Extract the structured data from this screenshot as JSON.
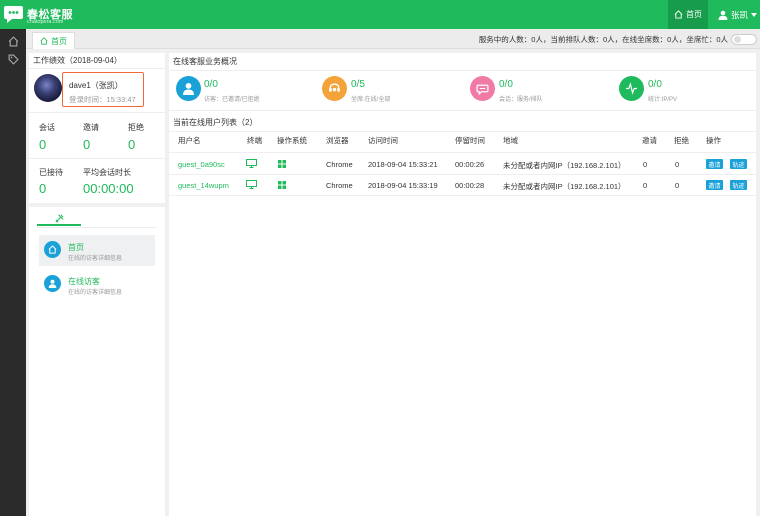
{
  "header": {
    "logo_name": "春松客服",
    "logo_sub": "chatopera.com",
    "home_label": "首页",
    "user_label": "张凯"
  },
  "tabbar": {
    "tab_home": "首页",
    "status_text": "服务中的人数：0人，当前排队人数：0人，在线坐席数：0人，坐席忙：0人"
  },
  "left": {
    "title": "工作绩效（2018-09-04）",
    "username": "dave1（张凯）",
    "login_time": "登录时间：15:33:47",
    "stats": [
      {
        "label": "会话",
        "value": "0"
      },
      {
        "label": "邀请",
        "value": "0"
      },
      {
        "label": "拒绝",
        "value": "0"
      }
    ],
    "handled_label": "已接待",
    "handled_value": "0",
    "avg_label": "平均会话时长",
    "avg_value": "00:00:00"
  },
  "nav": {
    "items": [
      {
        "title": "首页",
        "sub": "在线的访客详细信息"
      },
      {
        "title": "在线访客",
        "sub": "在线的访客详细信息"
      }
    ]
  },
  "overview": {
    "title": "在线客服业务概况",
    "kpis": [
      {
        "value": "0/0",
        "label": "访客：已邀请/已拒绝",
        "color": "#1aa1d8"
      },
      {
        "value": "0/5",
        "label": "坐席:在线/全部",
        "color": "#f2a33a"
      },
      {
        "value": "0/0",
        "label": "会话：服务/排队",
        "color": "#f079a6"
      },
      {
        "value": "0/0",
        "label": "统计:IP/PV",
        "color": "#1fba5b"
      }
    ]
  },
  "table": {
    "title": "当前在线用户列表（2）",
    "columns": [
      "用户名",
      "终端",
      "操作系统",
      "浏览器",
      "访问时间",
      "停留时间",
      "地域",
      "邀请",
      "拒绝",
      "操作"
    ],
    "rows": [
      {
        "user": "guest_0a90sc",
        "browser": "Chrome",
        "visit_time": "2018-09-04 15:33:21",
        "stay": "00:00:26",
        "region": "未分配或者内网IP（192.168.2.101）",
        "invite": "0",
        "reject": "0",
        "btn_invite": "邀请",
        "btn_track": "轨迹"
      },
      {
        "user": "guest_14wupm",
        "browser": "Chrome",
        "visit_time": "2018-09-04 15:33:19",
        "stay": "00:00:28",
        "region": "未分配或者内网IP（192.168.2.101）",
        "invite": "0",
        "reject": "0",
        "btn_invite": "邀请",
        "btn_track": "轨迹"
      }
    ]
  },
  "colors": {
    "brand": "#1fba5b",
    "sidebar": "#2b2b2b",
    "button": "#1aa1d8",
    "highlight": "#ef6a37"
  }
}
